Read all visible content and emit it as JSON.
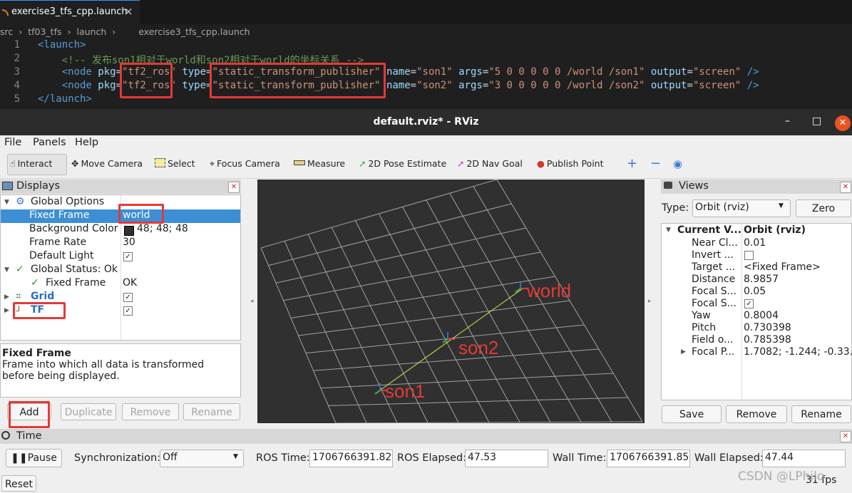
{
  "editor": {
    "tab_title": "exercise3_tfs_cpp.launch",
    "tab_close": "×",
    "breadcrumbs": [
      "src",
      "›",
      "tf03_tfs",
      "›",
      "launch",
      "›",
      "exercise3_tfs_cpp.launch"
    ],
    "lines": [
      {
        "num": "1",
        "tokens": [
          {
            "t": "<launch>",
            "c": "tag"
          }
        ]
      },
      {
        "num": "2",
        "tokens": [
          {
            "t": "    <!-- 发布son1相对于world和son2相对于world的坐标关系 -->",
            "c": "cmt"
          }
        ]
      },
      {
        "num": "3",
        "tokens": [
          {
            "t": "    <node ",
            "c": "tag"
          },
          {
            "t": "pkg",
            "c": "attr"
          },
          {
            "t": "=",
            "c": ""
          },
          {
            "t": "\"tf2_ros\"",
            "c": "str"
          },
          {
            "t": " ",
            "c": ""
          },
          {
            "t": "type",
            "c": "attr"
          },
          {
            "t": "=",
            "c": ""
          },
          {
            "t": "\"static_transform_publisher\"",
            "c": "str"
          },
          {
            "t": " ",
            "c": ""
          },
          {
            "t": "name",
            "c": "attr"
          },
          {
            "t": "=",
            "c": ""
          },
          {
            "t": "\"son1\"",
            "c": "str"
          },
          {
            "t": " ",
            "c": ""
          },
          {
            "t": "args",
            "c": "attr"
          },
          {
            "t": "=",
            "c": ""
          },
          {
            "t": "\"5 0 0 0 0 0 /world /son1\"",
            "c": "str"
          },
          {
            "t": " ",
            "c": ""
          },
          {
            "t": "output",
            "c": "attr"
          },
          {
            "t": "=",
            "c": ""
          },
          {
            "t": "\"screen\"",
            "c": "str"
          },
          {
            "t": " />",
            "c": "tag"
          }
        ]
      },
      {
        "num": "4",
        "tokens": [
          {
            "t": "    <node ",
            "c": "tag"
          },
          {
            "t": "pkg",
            "c": "attr"
          },
          {
            "t": "=",
            "c": ""
          },
          {
            "t": "\"tf2_ros\"",
            "c": "str"
          },
          {
            "t": " ",
            "c": ""
          },
          {
            "t": "type",
            "c": "attr"
          },
          {
            "t": "=",
            "c": ""
          },
          {
            "t": "\"static_transform_publisher\"",
            "c": "str"
          },
          {
            "t": " ",
            "c": ""
          },
          {
            "t": "name",
            "c": "attr"
          },
          {
            "t": "=",
            "c": ""
          },
          {
            "t": "\"son2\"",
            "c": "str"
          },
          {
            "t": " ",
            "c": ""
          },
          {
            "t": "args",
            "c": "attr"
          },
          {
            "t": "=",
            "c": ""
          },
          {
            "t": "\"3 0 0 0 0 0 /world /son2\"",
            "c": "str"
          },
          {
            "t": " ",
            "c": ""
          },
          {
            "t": "output",
            "c": "attr"
          },
          {
            "t": "=",
            "c": ""
          },
          {
            "t": "\"screen\"",
            "c": "str"
          },
          {
            "t": " />",
            "c": "tag"
          }
        ]
      },
      {
        "num": "5",
        "tokens": [
          {
            "t": "</launch>",
            "c": "tag"
          }
        ]
      }
    ]
  },
  "window": {
    "title": "default.rviz* - RViz",
    "minimize": "–",
    "maximize": "□",
    "close": "✕"
  },
  "menu": [
    "File",
    "Panels",
    "Help"
  ],
  "toolbar": {
    "interact": "Interact",
    "move_camera": "Move Camera",
    "select": "Select",
    "focus_camera": "Focus Camera",
    "measure": "Measure",
    "pose_estimate": "2D Pose Estimate",
    "nav_goal": "2D Nav Goal",
    "publish_point": "Publish Point",
    "plus": "+",
    "minus": "−"
  },
  "displays": {
    "title": "Displays",
    "rows": {
      "global_options": "Global Options",
      "fixed_frame": "Fixed Frame",
      "fixed_frame_value": "world",
      "background_color": "Background Color",
      "background_color_value": "48; 48; 48",
      "background_color_swatch": "#303030",
      "frame_rate": "Frame Rate",
      "frame_rate_value": "30",
      "default_light": "Default Light",
      "global_status": "Global Status: Ok",
      "status_fixed_frame": "Fixed Frame",
      "status_fixed_frame_value": "OK",
      "grid": "Grid",
      "tf": "TF"
    },
    "desc_title": "Fixed Frame",
    "desc_body": "Frame into which all data is transformed before being displayed.",
    "buttons": {
      "add": "Add",
      "duplicate": "Duplicate",
      "remove": "Remove",
      "rename": "Rename"
    }
  },
  "viewport": {
    "labels": {
      "world": "world",
      "son2": "son2",
      "son1": "son1"
    },
    "label_color": "#e53935"
  },
  "views": {
    "title": "Views",
    "type_label": "Type:",
    "type_value": "Orbit (rviz)",
    "zero": "Zero",
    "header_name": "Current V...",
    "header_value": "Orbit (rviz)",
    "rows": [
      {
        "name": "Near Cl...",
        "value": "0.01"
      },
      {
        "name": "Invert ...",
        "value": ""
      },
      {
        "name": "Target ...",
        "value": "<Fixed Frame>"
      },
      {
        "name": "Distance",
        "value": "8.9857"
      },
      {
        "name": "Focal S...",
        "value": "0.05"
      },
      {
        "name": "Focal S...",
        "value": ""
      },
      {
        "name": "Yaw",
        "value": "0.8004"
      },
      {
        "name": "Pitch",
        "value": "0.730398"
      },
      {
        "name": "Field o...",
        "value": "0.785398"
      },
      {
        "name": "Focal P...",
        "value": "1.7082; -1.244; -0.33..."
      }
    ],
    "buttons": {
      "save": "Save",
      "remove": "Remove",
      "rename": "Rename"
    }
  },
  "time": {
    "title": "Time",
    "pause": "Pause",
    "sync_label": "Synchronization:",
    "sync_value": "Off",
    "ros_time_label": "ROS Time:",
    "ros_time": "1706766391.82",
    "ros_elapsed_label": "ROS Elapsed:",
    "ros_elapsed": "47.53",
    "wall_time_label": "Wall Time:",
    "wall_time": "1706766391.85",
    "wall_elapsed_label": "Wall Elapsed:",
    "wall_elapsed": "47.44",
    "reset": "Reset",
    "fps": "31 fps",
    "watermark": "CSDN @LPhilo"
  }
}
